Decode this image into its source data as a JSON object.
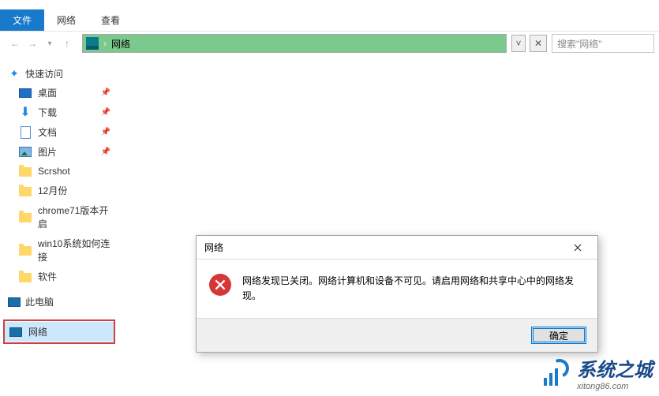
{
  "ribbon": {
    "file": "文件",
    "tab_network": "网络",
    "tab_view": "查看"
  },
  "address": {
    "location": "网络"
  },
  "search": {
    "placeholder": "搜索\"网络\""
  },
  "sidebar": {
    "quick_access": "快速访问",
    "items": [
      {
        "label": "桌面",
        "pinned": true
      },
      {
        "label": "下载",
        "pinned": true
      },
      {
        "label": "文档",
        "pinned": true
      },
      {
        "label": "图片",
        "pinned": true
      },
      {
        "label": "Scrshot",
        "pinned": false
      },
      {
        "label": "12月份",
        "pinned": false
      },
      {
        "label": "chrome71版本开启",
        "pinned": false
      },
      {
        "label": "win10系统如何连接",
        "pinned": false
      },
      {
        "label": "软件",
        "pinned": false
      }
    ],
    "this_pc": "此电脑",
    "network": "网络"
  },
  "dialog": {
    "title": "网络",
    "message": "网络发现已关闭。网络计算机和设备不可见。请启用网络和共享中心中的网络发现。",
    "ok": "确定"
  },
  "watermark": {
    "cn": "系统之城",
    "en": "xitong86.com"
  }
}
